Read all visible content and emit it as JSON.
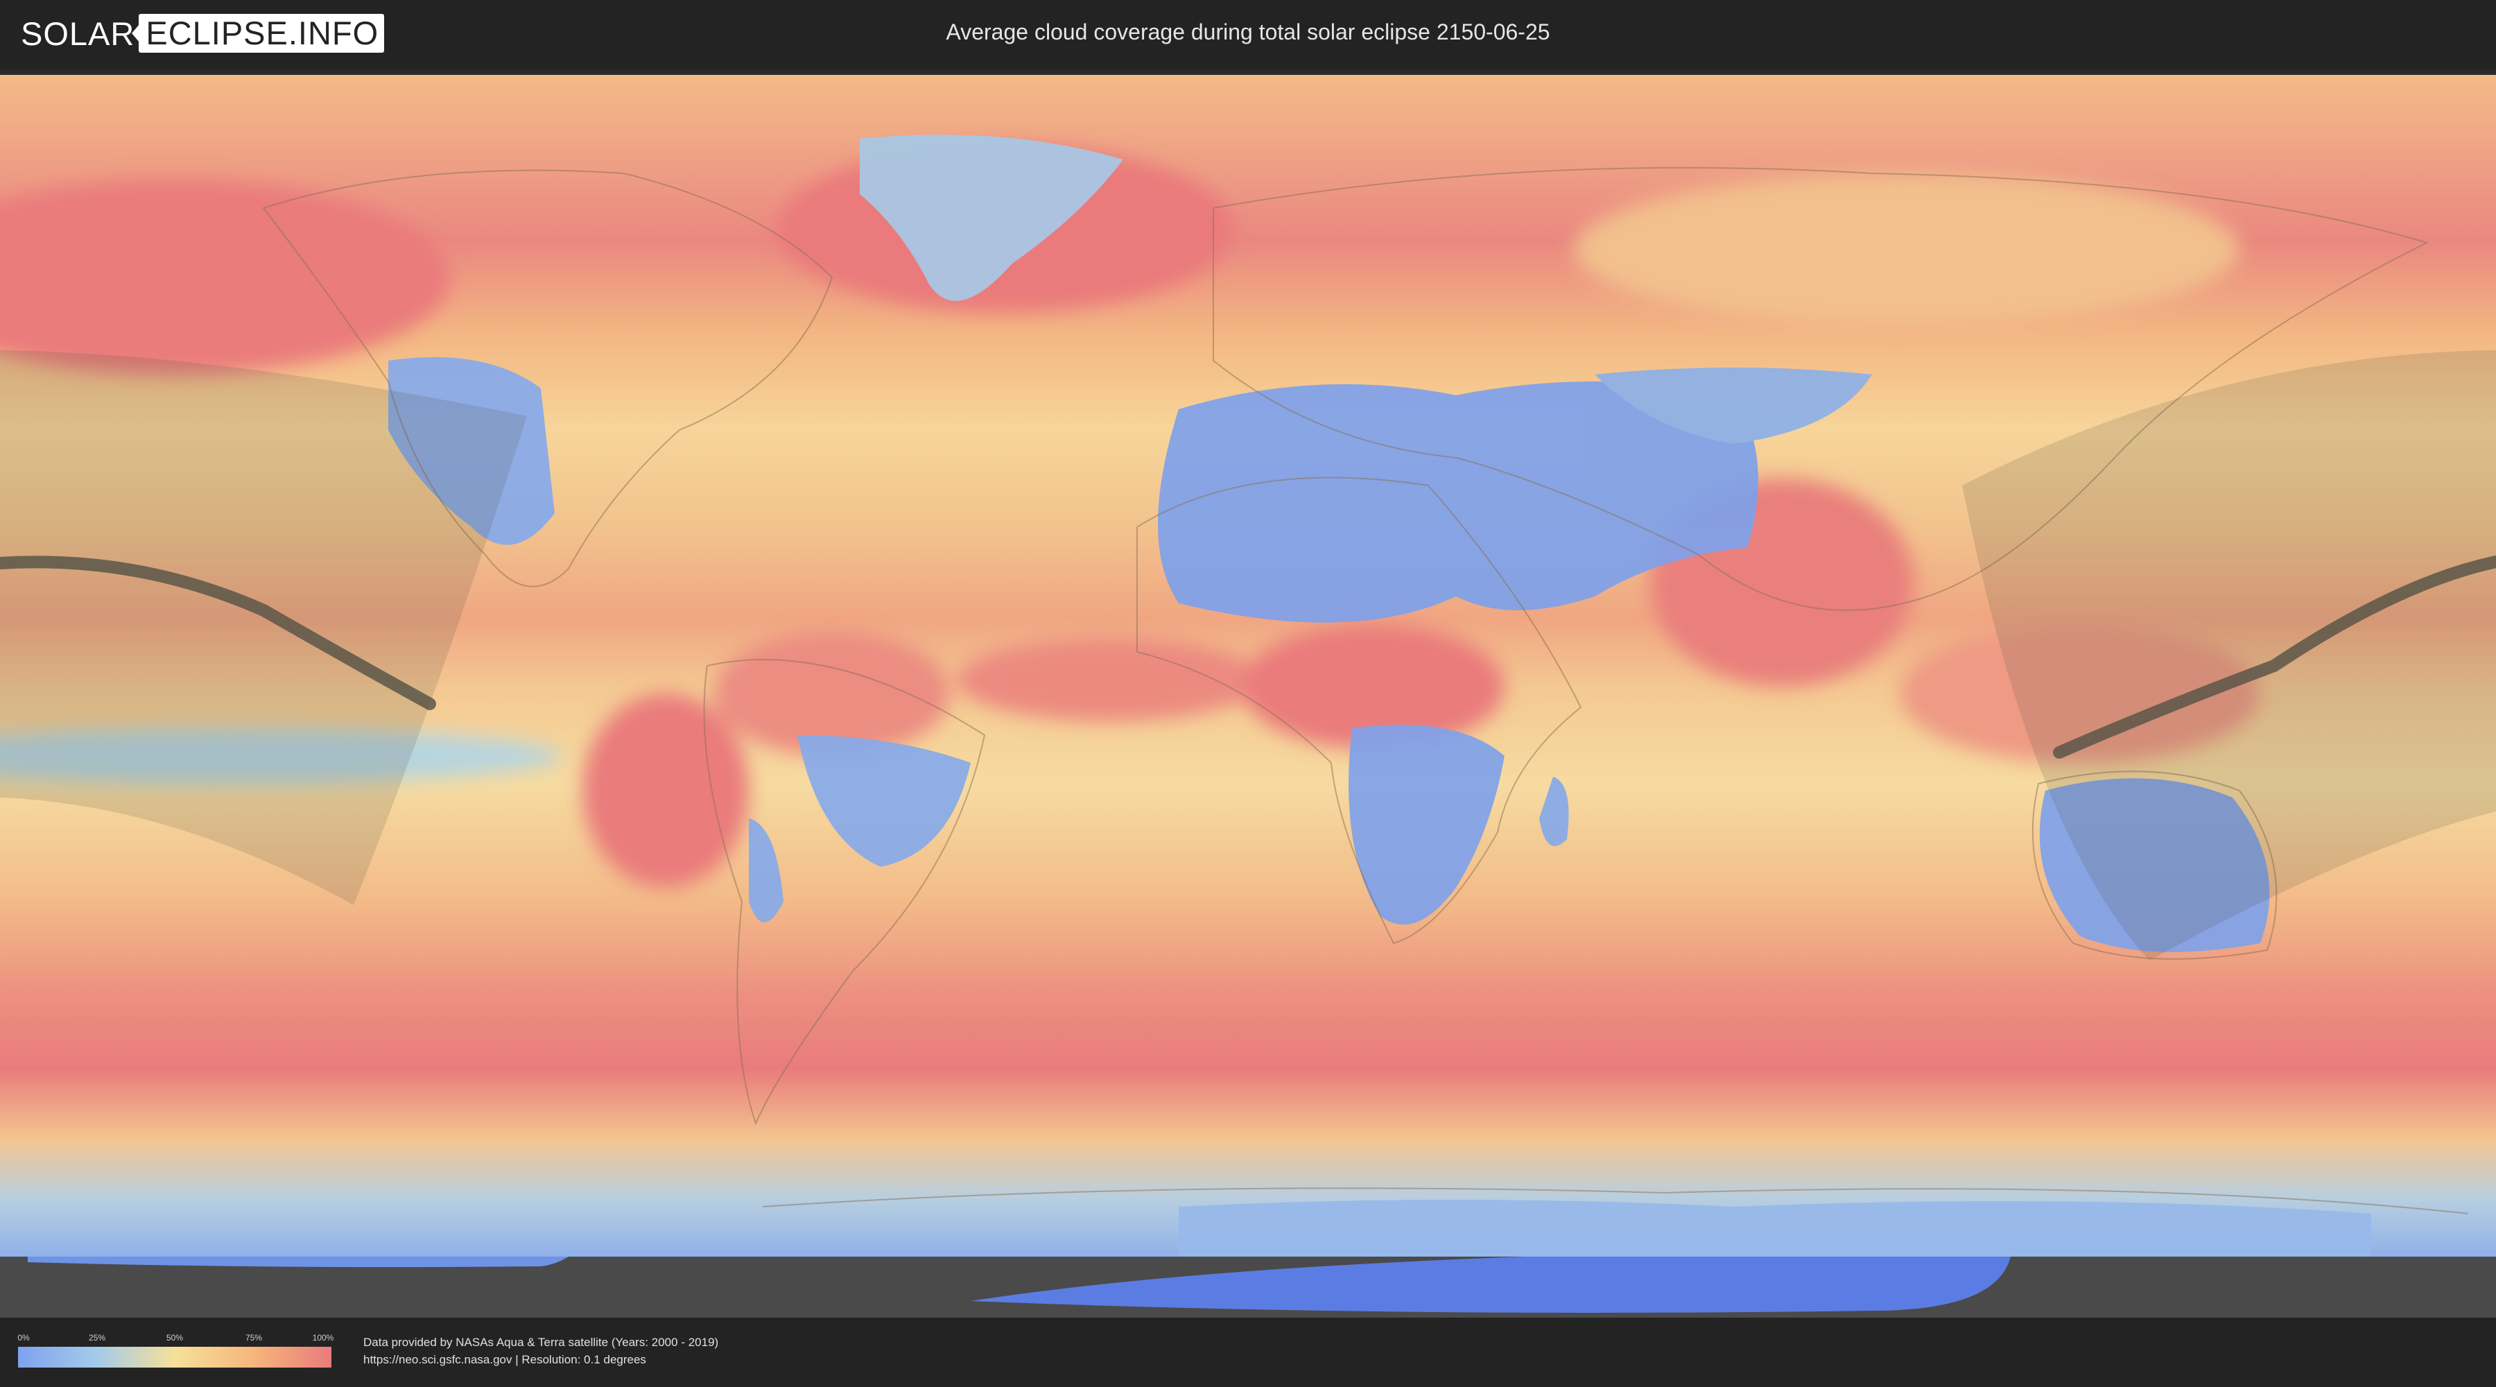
{
  "header": {
    "logo_left": "SOLAR",
    "logo_right": "ECLIPSE.INFO",
    "title": "Average cloud coverage during total solar eclipse 2150-06-25"
  },
  "map": {
    "type": "equirectangular world cloud-cover map",
    "eclipse_date": "2150-06-25",
    "path_color": "#5a5648",
    "colors": {
      "clear": "#7fa2ef",
      "low": "#a3cbe9",
      "medium": "#f6e09a",
      "high": "#f6b67c",
      "overcast": "#ea7b7c",
      "antarctic_ice": "#5b7de3"
    }
  },
  "legend": {
    "ticks": [
      "0%",
      "25%",
      "50%",
      "75%",
      "100%"
    ],
    "gradient": [
      "#7fa2ef",
      "#a3cbe9",
      "#f6e09a",
      "#f6b67c",
      "#ea7b7c"
    ]
  },
  "footer": {
    "credit_line1": "Data provided by NASAs Aqua & Terra satellite (Years: 2000 - 2019)",
    "credit_line2": "https://neo.sci.gsfc.nasa.gov | Resolution: 0.1 degrees"
  }
}
